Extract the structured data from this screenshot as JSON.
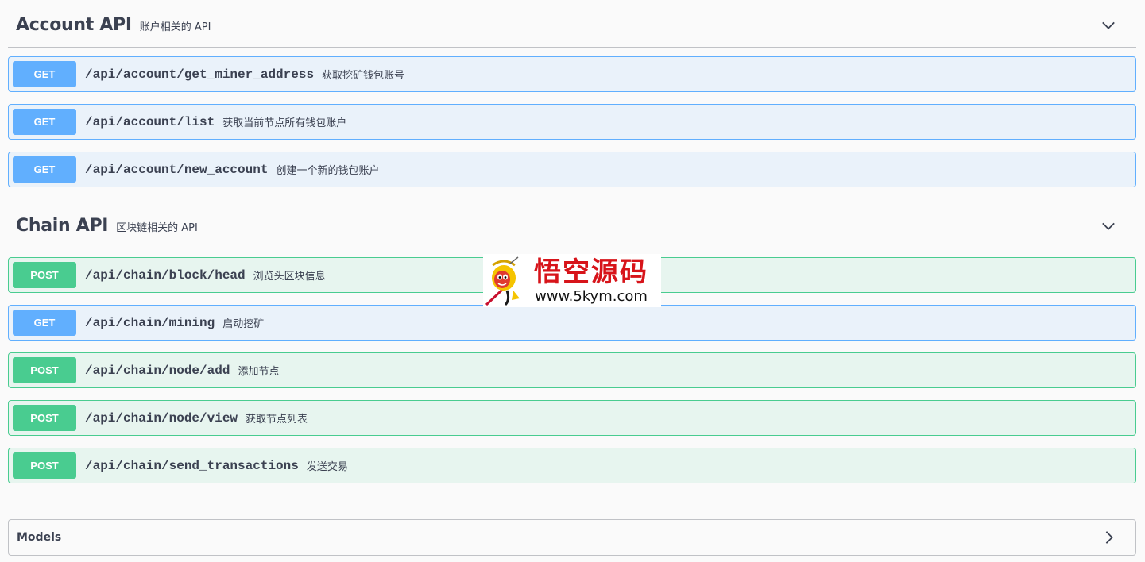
{
  "sections": [
    {
      "title": "Account API",
      "description": "账户相关的 API",
      "operations": [
        {
          "method": "GET",
          "path": "/api/account/get_miner_address",
          "summary": "获取挖矿钱包账号"
        },
        {
          "method": "GET",
          "path": "/api/account/list",
          "summary": "获取当前节点所有钱包账户"
        },
        {
          "method": "GET",
          "path": "/api/account/new_account",
          "summary": "创建一个新的钱包账户"
        }
      ]
    },
    {
      "title": "Chain API",
      "description": "区块链相关的 API",
      "operations": [
        {
          "method": "POST",
          "path": "/api/chain/block/head",
          "summary": "浏览头区块信息"
        },
        {
          "method": "GET",
          "path": "/api/chain/mining",
          "summary": "启动挖矿"
        },
        {
          "method": "POST",
          "path": "/api/chain/node/add",
          "summary": "添加节点"
        },
        {
          "method": "POST",
          "path": "/api/chain/node/view",
          "summary": "获取节点列表"
        },
        {
          "method": "POST",
          "path": "/api/chain/send_transactions",
          "summary": "发送交易"
        }
      ]
    }
  ],
  "models": {
    "title": "Models"
  },
  "watermark": {
    "title": "悟空源码",
    "url": "www.5kym.com"
  },
  "colors": {
    "get": "#61affe",
    "post": "#49cc90",
    "text": "#3b4151",
    "background": "#fafafa"
  },
  "icons": {
    "section_toggle": "chevron-down-icon",
    "models_toggle": "chevron-right-icon"
  }
}
